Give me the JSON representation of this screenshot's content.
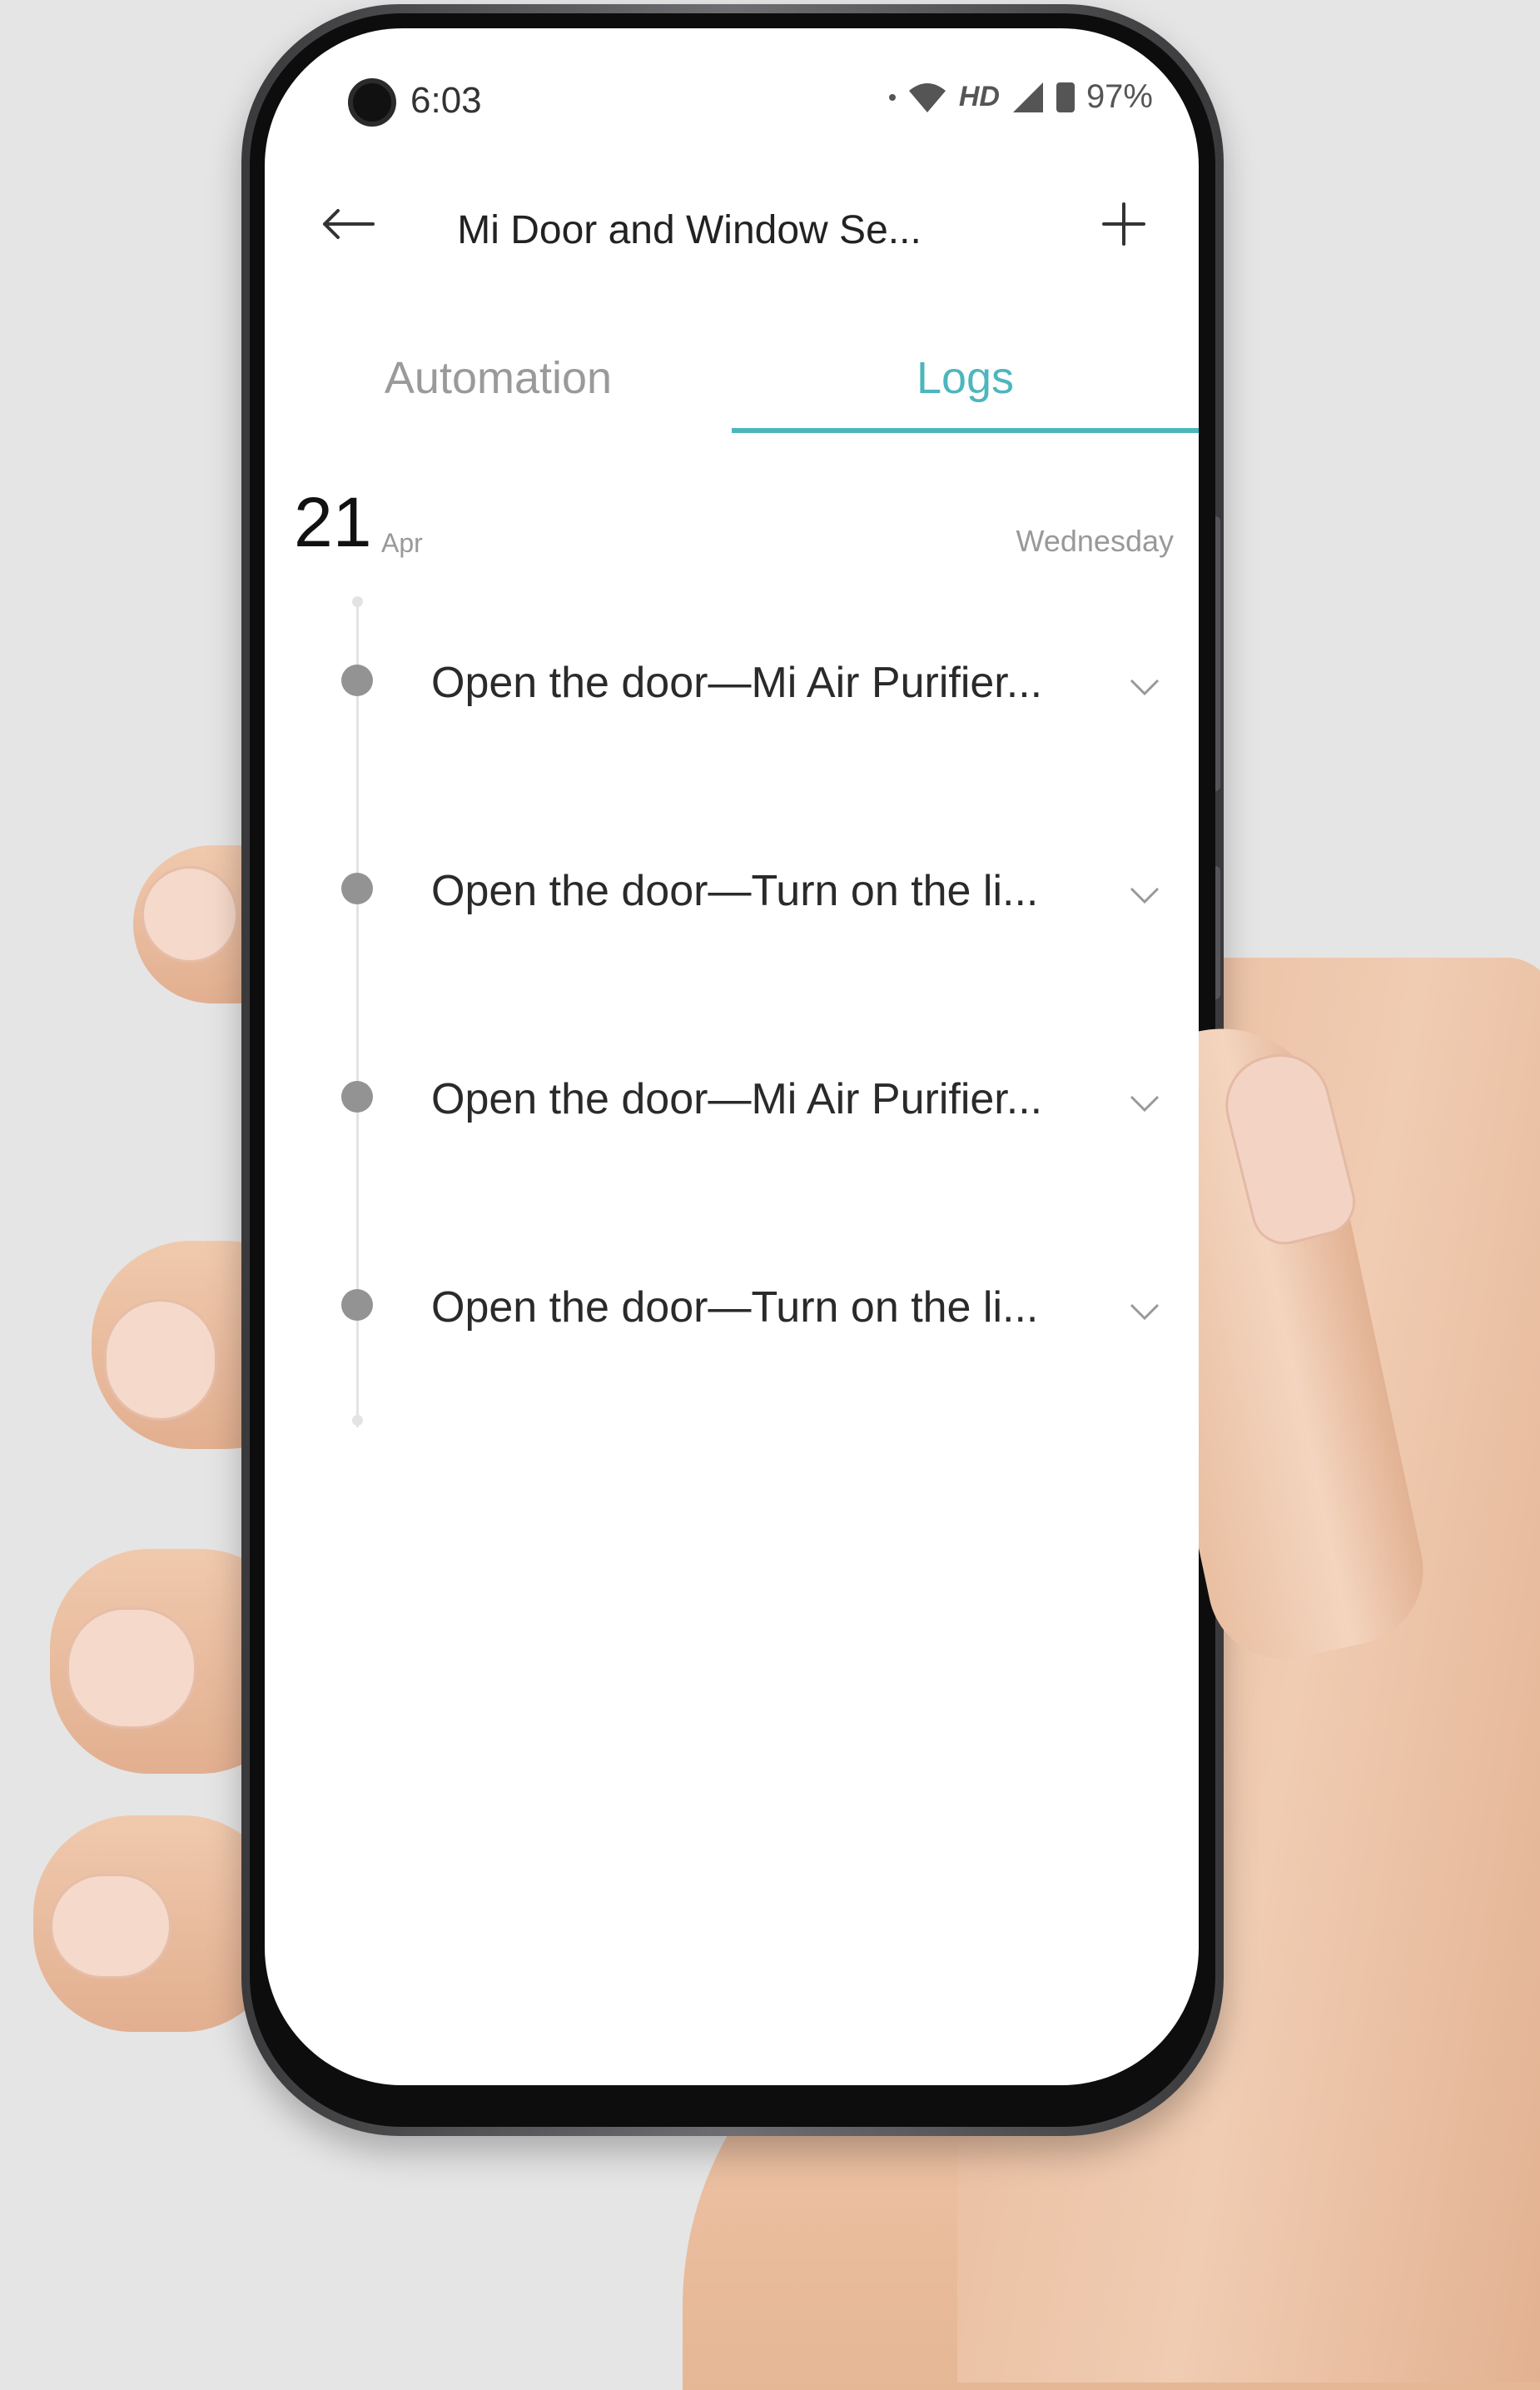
{
  "status_bar": {
    "time": "6:03",
    "network": "HD",
    "battery": "97%"
  },
  "header": {
    "title": "Mi Door and Window Se..."
  },
  "tabs": [
    {
      "label": "Automation",
      "active": false
    },
    {
      "label": "Logs",
      "active": true
    }
  ],
  "date": {
    "day": "21",
    "month": "Apr",
    "weekday": "Wednesday"
  },
  "logs": [
    {
      "text": "Open the door—Mi Air Purifier..."
    },
    {
      "text": "Open the door—Turn on the li..."
    },
    {
      "text": "Open the door—Mi Air Purifier..."
    },
    {
      "text": "Open the door—Turn on the li..."
    }
  ],
  "colors": {
    "accent": "#4db6bd",
    "timeline_dot": "#939393",
    "background": "#e5e5e6"
  },
  "icons": {
    "back": "arrow-left-icon",
    "add": "plus-icon",
    "expand": "chevron-down-icon"
  }
}
